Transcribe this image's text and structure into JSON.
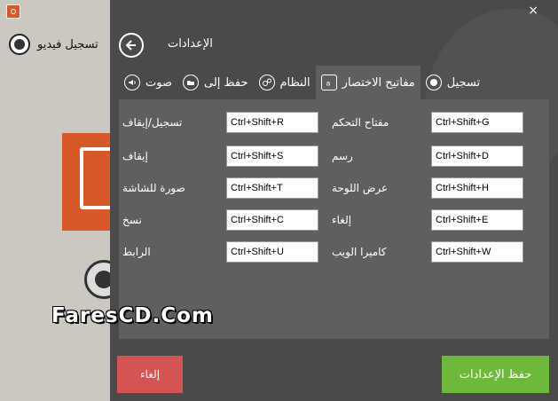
{
  "background_app": {
    "record_video_label": "تسجيل فيديو"
  },
  "panel": {
    "close": "×",
    "title": "الإعدادات"
  },
  "tabs": [
    {
      "label": "صوت",
      "icon": "speaker-icon"
    },
    {
      "label": "حفظ إلى",
      "icon": "folder-icon"
    },
    {
      "label": "النظام",
      "icon": "gears-icon"
    },
    {
      "label": "مفاتيح الاختصار",
      "icon": "keyboard-icon"
    },
    {
      "label": "تسجيل",
      "icon": "record-icon"
    }
  ],
  "hotkeys": {
    "left": [
      {
        "label": "تسجيل/إيقاف",
        "value": "Ctrl+Shift+R"
      },
      {
        "label": "إيقاف",
        "value": "Ctrl+Shift+S"
      },
      {
        "label": "صورة للشاشة",
        "value": "Ctrl+Shift+T"
      },
      {
        "label": "نسخ",
        "value": "Ctrl+Shift+C"
      },
      {
        "label": "الرابط",
        "value": "Ctrl+Shift+U"
      }
    ],
    "right": [
      {
        "label": "مفتاح التحكم",
        "value": "Ctrl+Shift+G"
      },
      {
        "label": "رسم",
        "value": "Ctrl+Shift+D"
      },
      {
        "label": "عرض اللوحة",
        "value": "Ctrl+Shift+H"
      },
      {
        "label": "إلغاء",
        "value": "Ctrl+Shift+E"
      },
      {
        "label": "كاميرا الويب",
        "value": "Ctrl+Shift+W"
      }
    ]
  },
  "watermark": "FaresCD.Com",
  "buttons": {
    "cancel": "إلغاء",
    "save": "حفظ الإعدادات"
  },
  "colors": {
    "panel_bg": "#4a4a4a",
    "content_bg": "#5f5f5f",
    "cancel": "#d45454",
    "save": "#6eb83c",
    "accent_orange": "#d9582a"
  }
}
